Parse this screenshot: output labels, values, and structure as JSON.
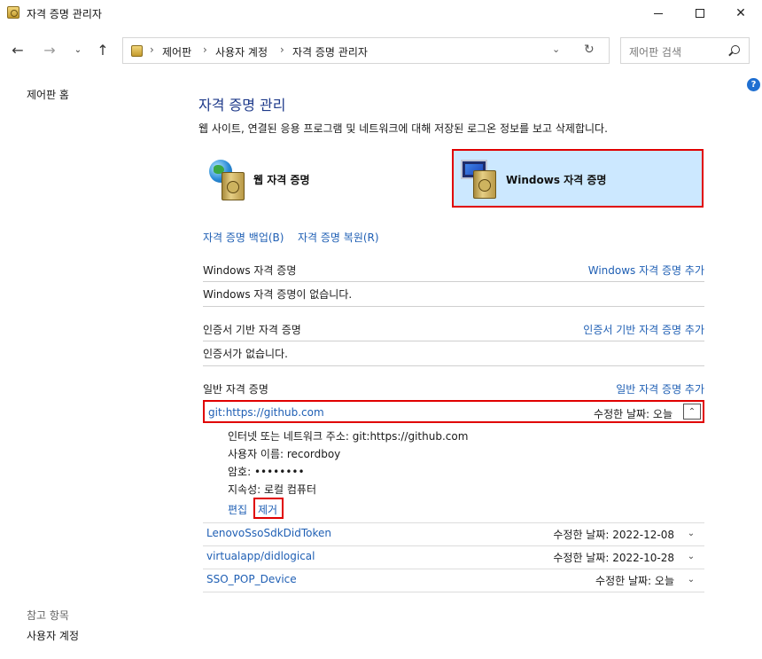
{
  "window": {
    "title": "자격 증명 관리자"
  },
  "nav": {
    "back": "←",
    "forward": "→",
    "recent": "⌄",
    "up": "↑",
    "breadcrumb": [
      "제어판",
      "사용자 계정",
      "자격 증명 관리자"
    ],
    "dropdown": "⌄",
    "refresh": "↻",
    "search_placeholder": "제어판 검색"
  },
  "sidebar": {
    "home": "제어판 홈",
    "reference_heading": "참고 항목",
    "user_accounts": "사용자 계정"
  },
  "main": {
    "title": "자격 증명 관리",
    "description": "웹 사이트, 연결된 응용 프로그램 및 네트워크에 대해 저장된 로그온 정보를 보고 삭제합니다.",
    "web_credentials": "웹 자격 증명",
    "windows_credentials": "Windows 자격 증명",
    "backup": "자격 증명 백업(B)",
    "restore": "자격 증명 복원(R)",
    "sections": {
      "windows": {
        "title": "Windows 자격 증명",
        "add": "Windows 자격 증명 추가",
        "empty": "Windows 자격 증명이 없습니다."
      },
      "certificate": {
        "title": "인증서 기반 자격 증명",
        "add": "인증서 기반 자격 증명 추가",
        "empty": "인증서가 없습니다."
      },
      "generic": {
        "title": "일반 자격 증명",
        "add": "일반 자격 증명 추가"
      }
    },
    "expanded": {
      "name": "git:https://github.com",
      "modified": "수정한 날짜:  오늘",
      "address": "인터넷 또는 네트워크 주소:  git:https://github.com",
      "username": "사용자 이름:  recordboy",
      "password": "암호:  ••••••••",
      "persistence": "지속성:  로컬 컴퓨터",
      "edit": "편집",
      "remove": "제거"
    },
    "credentials": [
      {
        "name": "LenovoSsoSdkDidToken",
        "modified": "수정한 날짜:  2022-12-08"
      },
      {
        "name": "virtualapp/didlogical",
        "modified": "수정한 날짜:  2022-10-28"
      },
      {
        "name": "SSO_POP_Device",
        "modified": "수정한 날짜:  오늘"
      }
    ]
  },
  "colors": {
    "link": "#1f5fb4",
    "title": "#1e3a8a",
    "selected_bg": "#cce8ff",
    "highlight_border": "#e00000",
    "help": "#1f6fd1"
  },
  "icons": {
    "app": "credential-vault-icon",
    "help": "help-icon",
    "search": "search-icon",
    "chevron_up": "chevron-up-icon",
    "chevron_down": "chevron-down-icon"
  }
}
